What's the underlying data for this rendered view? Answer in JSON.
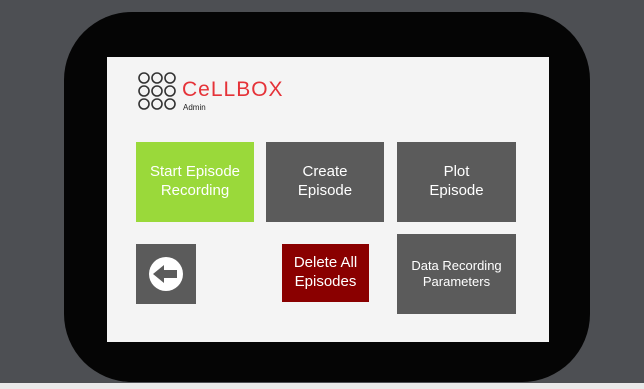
{
  "app": {
    "logo_text": "CeLLBOX",
    "logo_subtitle": "Admin",
    "brand_color": "#e53238"
  },
  "buttons": {
    "start_episode_recording": "Start Episode\nRecording",
    "create_episode": "Create\nEpisode",
    "plot_episode": "Plot\nEpisode",
    "delete_all_episodes": "Delete All\nEpisodes",
    "data_recording_parameters": "Data Recording\nParameters",
    "back_icon": "back-arrow-icon"
  },
  "colors": {
    "start_button": "#9ad93a",
    "neutral_button": "#5b5b5b",
    "delete_button": "#8a0000"
  }
}
